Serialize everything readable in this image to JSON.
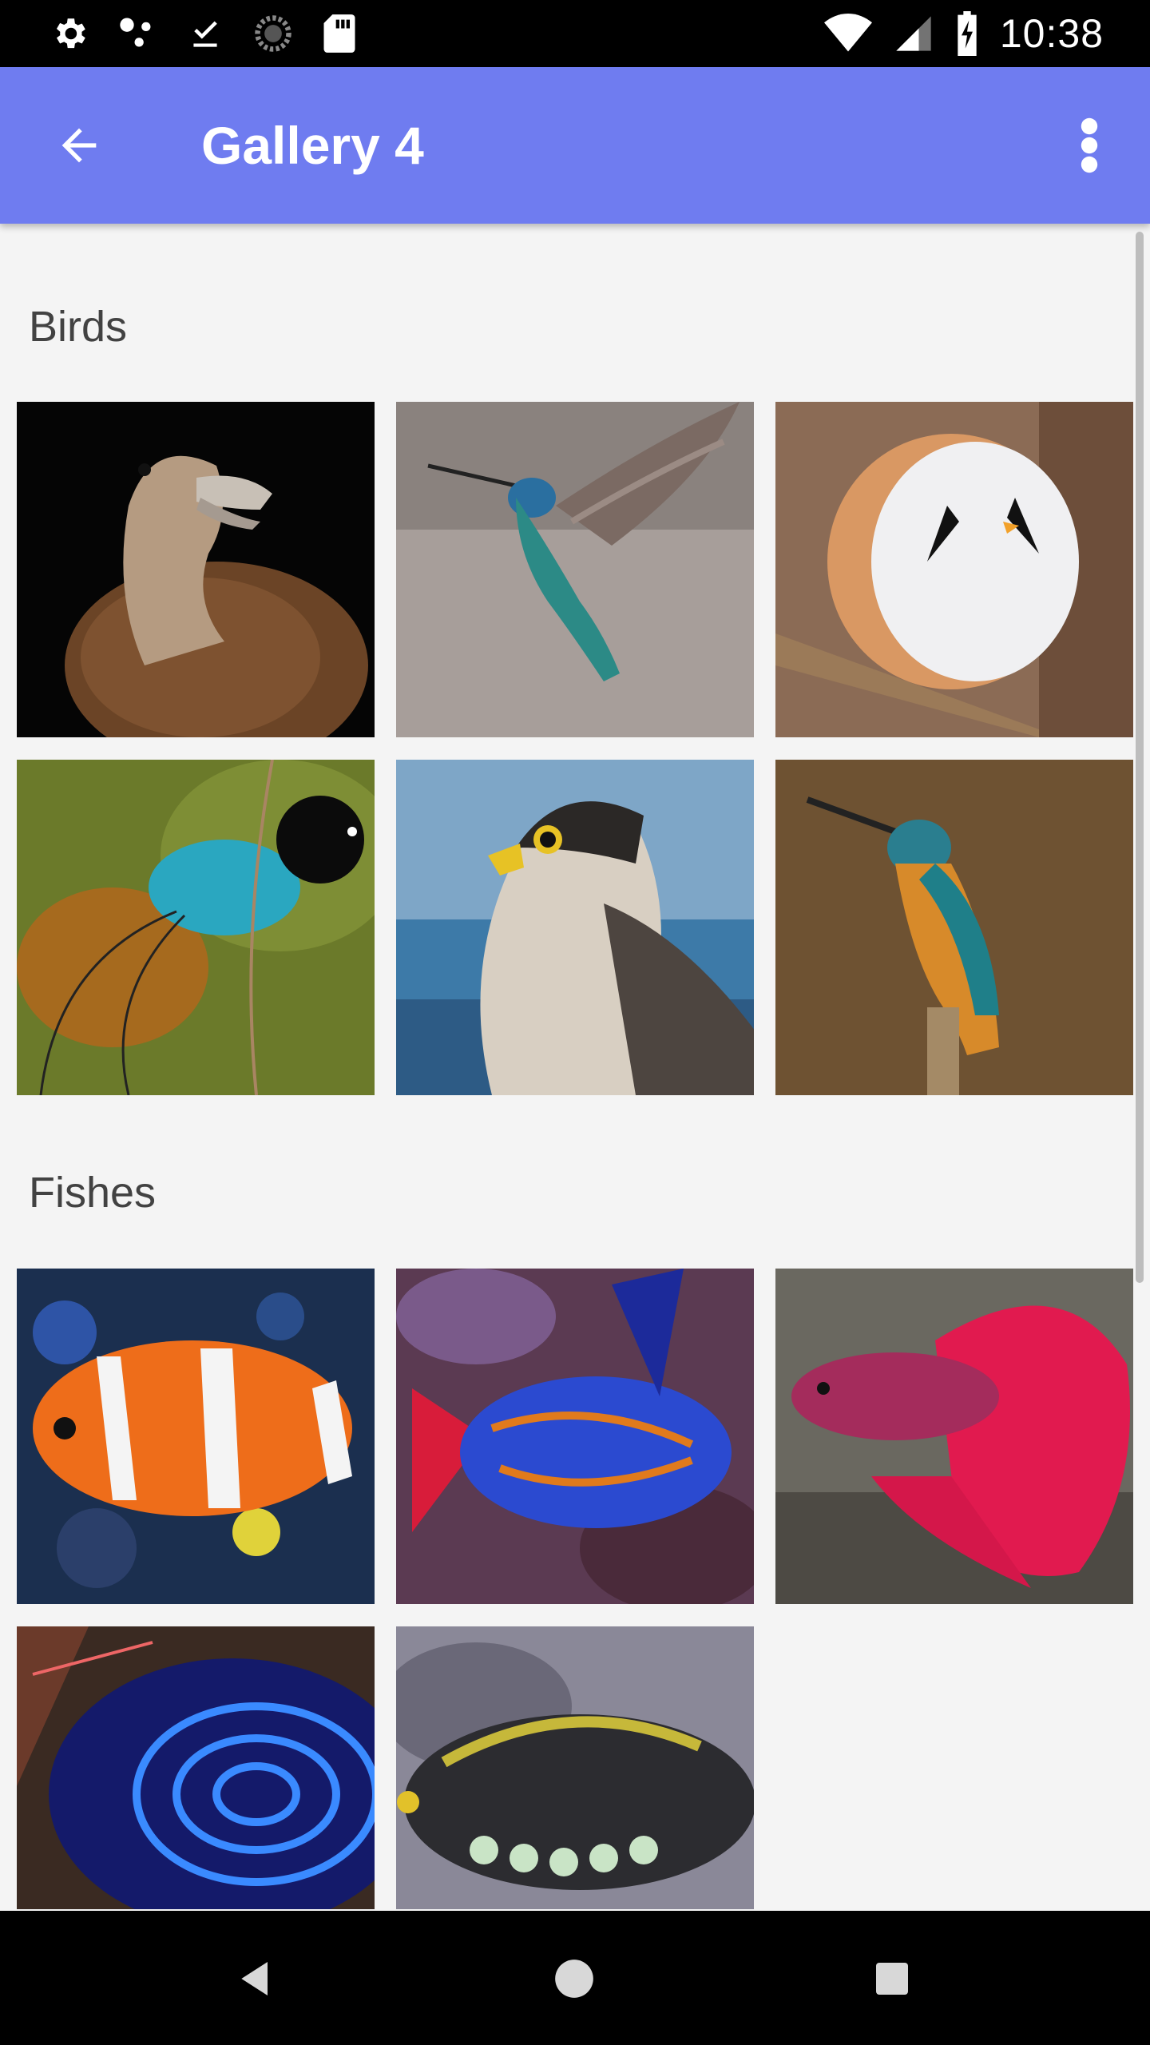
{
  "status_bar": {
    "time": "10:38",
    "left_icons": [
      "settings-icon",
      "dots-icon",
      "download-done-icon",
      "loading-icon",
      "sd-card-icon"
    ],
    "right_icons": [
      "wifi-icon",
      "cell-signal-icon",
      "battery-charging-icon"
    ]
  },
  "app_bar": {
    "title": "Gallery 4",
    "back_icon": "arrow-back-icon",
    "menu_icon": "more-vert-icon",
    "color": "#6f7cf0"
  },
  "sections": [
    {
      "title": "Birds",
      "items": [
        {
          "name": "duck"
        },
        {
          "name": "hummingbird"
        },
        {
          "name": "round-bird"
        },
        {
          "name": "bird-of-paradise"
        },
        {
          "name": "falcon"
        },
        {
          "name": "kingfisher"
        }
      ]
    },
    {
      "title": "Fishes",
      "items": [
        {
          "name": "clownfish"
        },
        {
          "name": "mandarinfish"
        },
        {
          "name": "betta-fish"
        },
        {
          "name": "angelfish"
        },
        {
          "name": "triggerfish"
        }
      ]
    }
  ],
  "nav_bar": {
    "back_icon": "nav-back-icon",
    "home_icon": "nav-home-icon",
    "recents_icon": "nav-recents-icon"
  }
}
